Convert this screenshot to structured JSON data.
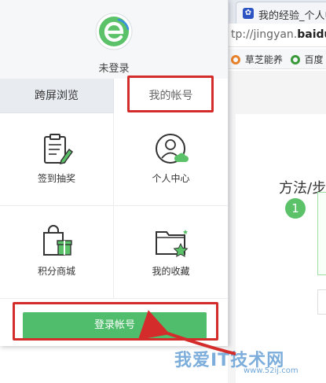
{
  "background_browser": {
    "tab_title": "我的经验_个人中",
    "address_prefix": "tp://jingyan.",
    "address_domain": "baidu",
    "bookmarks": [
      {
        "label": "草芝能养",
        "icon": "orange-ring-icon",
        "color": "#e8822a"
      },
      {
        "label": "百度",
        "icon": "green-ring-icon",
        "color": "#3a9a3a"
      }
    ],
    "method_heading": "方法/步",
    "step_number": "1",
    "watermark": "我爱IT技术网",
    "watermark_sub": "www.52ij.com"
  },
  "panel": {
    "logo": "green-e-browser-logo-icon",
    "user_status": "未登录",
    "tabs": [
      {
        "label": "跨屏浏览",
        "active": false
      },
      {
        "label": "我的帐号",
        "active": true
      }
    ],
    "grid": [
      {
        "label": "签到抽奖",
        "icon": "clipboard-pencil-icon"
      },
      {
        "label": "个人中心",
        "icon": "user-avatar-cloud-icon"
      },
      {
        "label": "积分商城",
        "icon": "shopping-bag-gift-icon"
      },
      {
        "label": "我的收藏",
        "icon": "folder-star-icon"
      }
    ],
    "login_button": "登录帐号"
  },
  "colors": {
    "accent_green": "#4fbd6b",
    "highlight_red": "#d42b2b"
  }
}
